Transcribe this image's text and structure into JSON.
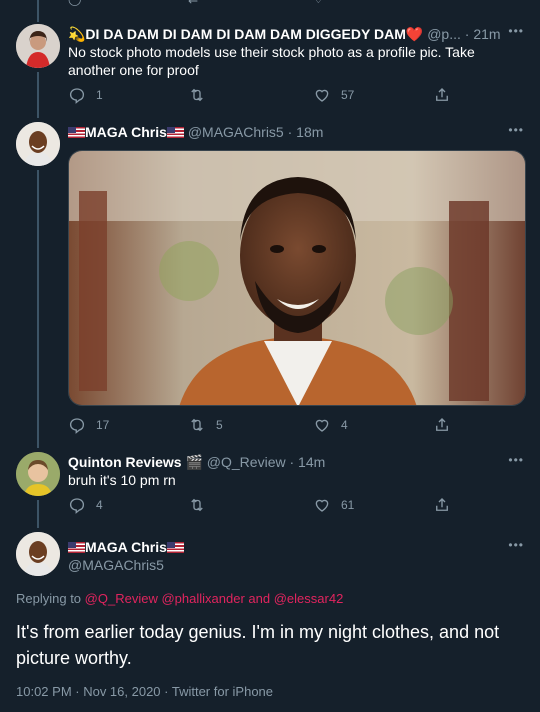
{
  "tweet1": {
    "name": "💫DI DA DAM DI DAM DI DAM DAM DIGGEDY DAM❤️",
    "handle": "@p...",
    "time": "· 21m",
    "text": "No stock photo models use their stock photo as a profile pic. Take another one for proof",
    "replies": "1",
    "retweets": "",
    "likes": "57"
  },
  "tweet2": {
    "name": "MAGA Chris",
    "handle": "@MAGAChris5",
    "time": "· 18m",
    "replies": "17",
    "retweets": "5",
    "likes": "4"
  },
  "tweet3": {
    "name": "Quinton Reviews 🎬",
    "handle": "@Q_Review",
    "time": "· 14m",
    "text": "bruh it's 10 pm rn",
    "replies": "4",
    "retweets": "",
    "likes": "61"
  },
  "main": {
    "name": "MAGA Chris",
    "handle": "@MAGAChris5",
    "replying_prefix": "Replying to",
    "mention1": "@Q_Review",
    "mention2": "@phallixander",
    "and_word": "and",
    "mention3": "@elessar42",
    "text": "It's from earlier today genius. I'm in my night clothes, and not picture worthy.",
    "timestamp": "10:02 PM · Nov 16, 2020 · Twitter for iPhone"
  },
  "colors": {
    "background": "#15202b",
    "accent": "#e0245e",
    "muted": "#8899a6"
  }
}
